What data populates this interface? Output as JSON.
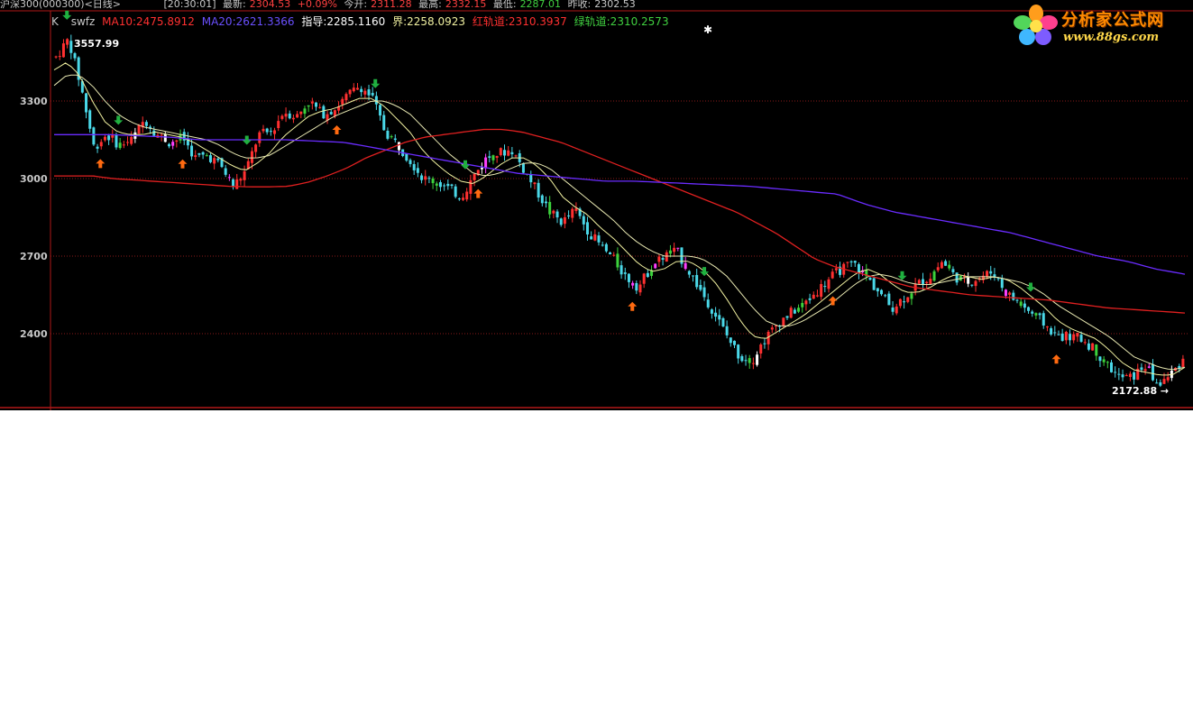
{
  "header": {
    "security": "沪深300(000300)<日线>",
    "time": "[20:30:01]",
    "latest_label": "最新:",
    "latest_value": "2304.53",
    "change": "+0.09%",
    "open_label": "今开:",
    "open_value": "2311.28",
    "high_label": "最高:",
    "high_value": "2332.15",
    "low_label": "最低:",
    "low_value": "2287.01",
    "prevclose_label": "昨收:",
    "prevclose_value": "2302.53"
  },
  "indicator_line": {
    "period": "K",
    "formula": "swfz",
    "ma10": "MA10:2475.8912",
    "ma20": "MA20:2621.3366",
    "guide": "指导:2285.1160",
    "bound": "界:2258.0923",
    "red_channel": "红轨道:2310.3937",
    "green_channel": "绿轨道:2310.2573"
  },
  "logo": {
    "name": "分析家公式网",
    "url": "www.88gs.com"
  },
  "colors": {
    "background": "#000000",
    "up_candle": "#ff3030",
    "down_candle": "#4ad8e8",
    "green_bar": "#3cd23c",
    "magenta_bar": "#ff40ff",
    "ma_red": "#e02020",
    "ma_purple": "#6a2cff",
    "guide_line": "#f0f0a0",
    "buy_arrow": "#ff6a10",
    "sell_arrow": "#20b040"
  },
  "chart_data": {
    "type": "line",
    "title": "",
    "xlabel": "",
    "ylabel": "",
    "ylim": [
      2172,
      3600
    ],
    "y_ticks": [
      2400,
      2700,
      3000,
      3300
    ],
    "grid": true,
    "max_label": "3557.99",
    "min_label": "2172.88",
    "x": [
      0,
      2,
      5,
      10,
      15,
      20,
      25,
      30,
      35,
      40,
      45,
      50,
      55,
      60,
      65,
      70,
      75,
      80,
      85,
      90,
      95,
      100,
      105,
      110,
      115,
      120,
      125,
      130,
      135,
      140,
      145,
      150,
      155,
      160,
      165,
      170,
      175,
      180,
      185,
      190,
      195,
      200,
      205,
      210,
      215,
      220,
      225,
      230,
      235,
      240,
      245,
      250,
      255,
      260,
      265,
      270,
      275,
      280,
      285,
      290,
      295,
      300,
      305,
      310,
      315,
      320,
      325,
      330,
      335,
      340,
      345,
      350,
      355,
      360,
      365,
      370,
      375,
      380,
      385,
      390,
      395,
      400,
      405,
      410,
      415,
      420,
      425,
      430,
      435,
      440
    ],
    "series": [
      {
        "name": "close",
        "values": [
          3470,
          3540,
          3350,
          3120,
          3170,
          3130,
          3150,
          3230,
          3170,
          3140,
          3160,
          3080,
          3090,
          3050,
          2970,
          3030,
          3170,
          3180,
          3260,
          3240,
          3300,
          3250,
          3270,
          3320,
          3360,
          3310,
          3180,
          3130,
          3070,
          3000,
          2990,
          2960,
          2930,
          3010,
          3080,
          3100,
          3110,
          3030,
          2950,
          2870,
          2830,
          2880,
          2800,
          2740,
          2690,
          2620,
          2580,
          2660,
          2700,
          2720,
          2640,
          2560,
          2480,
          2390,
          2310,
          2300,
          2380,
          2440,
          2480,
          2510,
          2560,
          2610,
          2650,
          2670,
          2620,
          2560,
          2500,
          2540,
          2590,
          2620,
          2680,
          2620,
          2600,
          2620,
          2640,
          2560,
          2520,
          2480,
          2440,
          2390,
          2390,
          2380,
          2340,
          2280,
          2230,
          2230,
          2280,
          2200,
          2240,
          2300
        ]
      },
      {
        "name": "",
        "values": [
          3420,
          3450,
          3400,
          3300,
          3220,
          3180,
          3170,
          3170,
          3180,
          3170,
          3160,
          3140,
          3110,
          3080,
          3050,
          3030,
          3060,
          3100,
          3160,
          3200,
          3240,
          3260,
          3270,
          3290,
          3310,
          3310,
          3280,
          3230,
          3180,
          3110,
          3060,
          3020,
          2990,
          2980,
          3010,
          3050,
          3080,
          3080,
          3050,
          3000,
          2930,
          2890,
          2860,
          2810,
          2770,
          2720,
          2670,
          2640,
          2650,
          2680,
          2680,
          2650,
          2600,
          2530,
          2450,
          2390,
          2380,
          2410,
          2440,
          2470,
          2510,
          2550,
          2590,
          2630,
          2650,
          2630,
          2590,
          2560,
          2560,
          2580,
          2610,
          2630,
          2620,
          2610,
          2620,
          2610,
          2580,
          2540,
          2500,
          2450,
          2420,
          2400,
          2380,
          2340,
          2290,
          2260,
          2250,
          2240,
          2240,
          2270
        ]
      },
      {
        "name": "",
        "values": [
          3360,
          3400,
          3400,
          3360,
          3300,
          3250,
          3220,
          3200,
          3190,
          3180,
          3170,
          3160,
          3150,
          3130,
          3100,
          3080,
          3080,
          3090,
          3120,
          3150,
          3180,
          3210,
          3240,
          3260,
          3280,
          3300,
          3300,
          3280,
          3250,
          3200,
          3150,
          3100,
          3060,
          3020,
          3010,
          3020,
          3040,
          3060,
          3060,
          3040,
          3000,
          2960,
          2920,
          2880,
          2840,
          2790,
          2750,
          2720,
          2700,
          2700,
          2700,
          2690,
          2660,
          2620,
          2560,
          2500,
          2450,
          2430,
          2430,
          2450,
          2480,
          2510,
          2550,
          2590,
          2620,
          2630,
          2620,
          2600,
          2590,
          2590,
          2600,
          2610,
          2620,
          2620,
          2620,
          2610,
          2600,
          2580,
          2550,
          2510,
          2480,
          2450,
          2420,
          2390,
          2350,
          2310,
          2290,
          2270,
          2260,
          2270
        ]
      },
      {
        "name": "",
        "values": [
          3010,
          3010,
          3010,
          3000,
          2995,
          2990,
          2985,
          2980,
          2975,
          2970,
          2968,
          2968,
          2970,
          2985,
          3010,
          3040,
          3080,
          3110,
          3140,
          3160,
          3170,
          3180,
          3190,
          3190,
          3180,
          3160,
          3140,
          3110,
          3080,
          3050,
          3020,
          2990,
          2960,
          2930,
          2900,
          2870,
          2830,
          2790,
          2740,
          2690,
          2660,
          2640,
          2620,
          2600,
          2580,
          2570,
          2560,
          2550,
          2545,
          2540,
          2535,
          2530,
          2520,
          2510,
          2500,
          2495,
          2490,
          2485,
          2480
        ]
      },
      {
        "name": "",
        "values": [
          3170,
          3170,
          3170,
          3165,
          3160,
          3150,
          3150,
          3150,
          3150,
          3145,
          3140,
          3120,
          3100,
          3080,
          3060,
          3040,
          3020,
          3010,
          3000,
          2990,
          2990,
          2985,
          2980,
          2975,
          2970,
          2960,
          2950,
          2940,
          2900,
          2870,
          2850,
          2830,
          2810,
          2790,
          2760,
          2730,
          2700,
          2680,
          2650,
          2630
        ]
      }
    ],
    "buy_signals_x": [
      18,
      50,
      110,
      165,
      225,
      303,
      390
    ],
    "sell_signals_x": [
      5,
      25,
      75,
      125,
      160,
      253,
      330,
      380
    ]
  }
}
